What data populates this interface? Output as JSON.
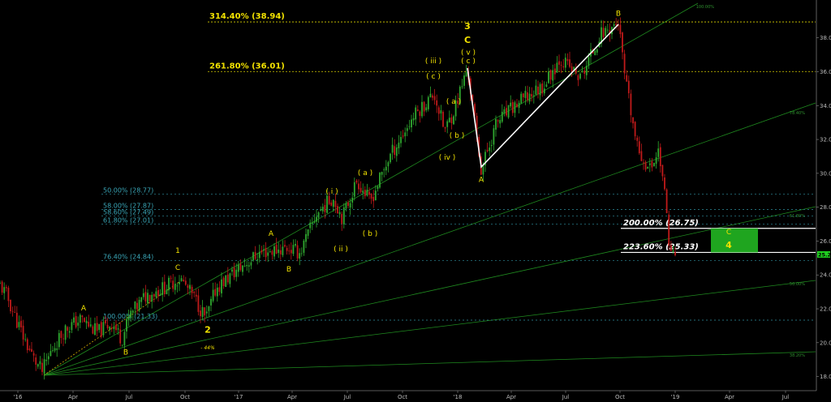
{
  "chart_data": {
    "type": "candlestick",
    "x_ticks": [
      "'16",
      "Apr",
      "Jul",
      "Oct",
      "'17",
      "Apr",
      "Jul",
      "Oct",
      "'18",
      "Apr",
      "Jul",
      "Oct",
      "'19",
      "Apr",
      "Jul"
    ],
    "y_ticks": [
      "18.00",
      "20.00",
      "22.00",
      "24.00",
      "26.00",
      "28.00",
      "30.00",
      "32.00",
      "34.00",
      "36.00",
      "38.00"
    ],
    "ylim": [
      18,
      39.5
    ],
    "last_price": "25.21",
    "price_path": [
      [
        0,
        23.4
      ],
      [
        8,
        22.8
      ],
      [
        18,
        21.6
      ],
      [
        30,
        20.2
      ],
      [
        42,
        19.0
      ],
      [
        52,
        18.3
      ],
      [
        64,
        19.6
      ],
      [
        80,
        20.8
      ],
      [
        100,
        21.4
      ],
      [
        120,
        20.6
      ],
      [
        138,
        21.2
      ],
      [
        150,
        20.2
      ],
      [
        160,
        21.6
      ],
      [
        180,
        22.8
      ],
      [
        200,
        23.2
      ],
      [
        222,
        23.8
      ],
      [
        240,
        22.6
      ],
      [
        254,
        21.4
      ],
      [
        266,
        23.2
      ],
      [
        290,
        24.2
      ],
      [
        320,
        25.3
      ],
      [
        354,
        25.6
      ],
      [
        370,
        25.3
      ],
      [
        390,
        27.6
      ],
      [
        410,
        28.6
      ],
      [
        422,
        27.4
      ],
      [
        440,
        29.6
      ],
      [
        456,
        28.3
      ],
      [
        480,
        31.0
      ],
      [
        510,
        33.4
      ],
      [
        535,
        34.7
      ],
      [
        548,
        32.5
      ],
      [
        560,
        33.8
      ],
      [
        576,
        36.2
      ],
      [
        593,
        30.2
      ],
      [
        612,
        33.0
      ],
      [
        640,
        34.2
      ],
      [
        670,
        35.2
      ],
      [
        690,
        36.8
      ],
      [
        715,
        35.6
      ],
      [
        740,
        38.2
      ],
      [
        762,
        38.9
      ],
      [
        770,
        35.6
      ],
      [
        785,
        31.5
      ],
      [
        800,
        30.2
      ],
      [
        812,
        31.4
      ],
      [
        818,
        29.2
      ],
      [
        826,
        25.3
      ],
      [
        834,
        25.2
      ]
    ],
    "fib_levels": [
      {
        "label": "314.40% (38.94)",
        "value": 38.94,
        "style": "yellow"
      },
      {
        "label": "261.80% (36.01)",
        "value": 36.01,
        "style": "yellow"
      },
      {
        "label": "50.00% (28.77)",
        "value": 28.77,
        "style": "cyan"
      },
      {
        "label": "58.00% (27.87)",
        "value": 27.87,
        "style": "cyan"
      },
      {
        "label": "58.60% (27.49)",
        "value": 27.49,
        "style": "cyan"
      },
      {
        "label": "61.80% (27.01)",
        "value": 27.01,
        "style": "cyan"
      },
      {
        "label": "76.40% (24.84)",
        "value": 24.84,
        "style": "cyan"
      },
      {
        "label": "100.00% (21.33)",
        "value": 21.33,
        "style": "cyan"
      },
      {
        "label": "200.00% (26.75)",
        "value": 26.75,
        "style": "white"
      },
      {
        "label": "223.60% (25.33)",
        "value": 25.33,
        "style": "white"
      }
    ],
    "fan_labels": [
      "100.00%",
      "78.40%",
      "61.80%",
      "50.00%",
      "38.20%"
    ],
    "wave_labels": [
      {
        "text": "A",
        "x": 103,
        "y": 21.9,
        "size": "small"
      },
      {
        "text": "B",
        "x": 155,
        "y": 19.3,
        "size": "small"
      },
      {
        "text": "C",
        "x": 219,
        "y": 24.3,
        "size": "small"
      },
      {
        "text": "1",
        "x": 219,
        "y": 25.3,
        "size": "small"
      },
      {
        "text": "2",
        "x": 256,
        "y": 20.6,
        "size": "big"
      },
      {
        "text": "- 44%",
        "x": 256,
        "y": 19.6,
        "size": "tiny"
      },
      {
        "text": "A",
        "x": 334,
        "y": 26.3,
        "size": "small"
      },
      {
        "text": "B",
        "x": 356,
        "y": 24.2,
        "size": "small"
      },
      {
        "text": "( i )",
        "x": 409,
        "y": 28.8,
        "size": "small"
      },
      {
        "text": "( ii )",
        "x": 420,
        "y": 25.4,
        "size": "small"
      },
      {
        "text": "( a )",
        "x": 450,
        "y": 29.9,
        "size": "small"
      },
      {
        "text": "( b )",
        "x": 456,
        "y": 26.3,
        "size": "small"
      },
      {
        "text": "( iii )",
        "x": 534,
        "y": 36.5,
        "size": "small"
      },
      {
        "text": "( c )",
        "x": 534,
        "y": 35.6,
        "size": "small"
      },
      {
        "text": "( a )",
        "x": 559,
        "y": 34.1,
        "size": "small"
      },
      {
        "text": "( b )",
        "x": 563,
        "y": 32.1,
        "size": "small"
      },
      {
        "text": "( iv )",
        "x": 551,
        "y": 30.8,
        "size": "small"
      },
      {
        "text": "3",
        "x": 576,
        "y": 38.5,
        "size": "big"
      },
      {
        "text": "C",
        "x": 576,
        "y": 37.7,
        "size": "big"
      },
      {
        "text": "( v )",
        "x": 577,
        "y": 37.0,
        "size": "small"
      },
      {
        "text": "( c )",
        "x": 577,
        "y": 36.5,
        "size": "small"
      },
      {
        "text": "A",
        "x": 593,
        "y": 29.5,
        "size": "small"
      },
      {
        "text": "B",
        "x": 762,
        "y": 39.3,
        "size": "small"
      },
      {
        "text": "C",
        "x": 898,
        "y": 26.4,
        "size": "small"
      },
      {
        "text": "4",
        "x": 898,
        "y": 25.6,
        "size": "big"
      }
    ],
    "target_box": {
      "x_start": 876,
      "x_end": 934,
      "y_top": 26.75,
      "y_bottom": 25.33
    }
  },
  "colors": {
    "background": "#000000",
    "fan_line": "#1f8a1f",
    "fib_yellow": "#d8d000",
    "fib_cyan": "#2f8fa0",
    "fib_white": "#ffffff",
    "wave_label": "#f2e200",
    "target_box": "#1fa51f",
    "candle_up": "#2fa82f",
    "candle_down": "#c01a1a",
    "price_tag": "#1fcf1f"
  }
}
